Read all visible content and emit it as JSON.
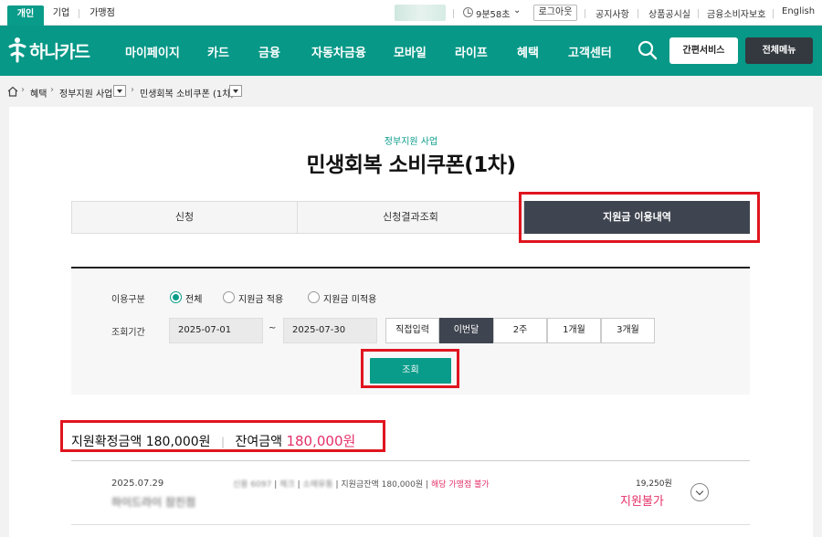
{
  "topbar": {
    "segments": [
      "개인",
      "기업",
      "가맹점"
    ],
    "timer": "9분58초",
    "logout": "로그아웃",
    "links": [
      "공지사항",
      "상품공시실",
      "금융소비자보호",
      "English"
    ]
  },
  "nav": {
    "logo": "하나카드",
    "items": [
      "마이페이지",
      "카드",
      "금융",
      "자동차금융",
      "모바일",
      "라이프",
      "혜택",
      "고객센터"
    ],
    "simple_service": "간편서비스",
    "all_menu": "전체메뉴"
  },
  "breadcrumb": {
    "items": [
      "혜택",
      "정부지원 사업",
      "민생회복 소비쿠폰 (1차)"
    ]
  },
  "page": {
    "subtitle": "정부지원 사업",
    "title": "민생회복 소비쿠폰(1차)"
  },
  "tabs": [
    "신청",
    "신청결과조회",
    "지원금 이용내역"
  ],
  "filter": {
    "usage_label": "이용구분",
    "radios": [
      "전체",
      "지원금 적용",
      "지원금 미적용"
    ],
    "period_label": "조회기간",
    "date_from": "2025-07-01",
    "tilde": "~",
    "date_to": "2025-07-30",
    "periods": [
      "직접입력",
      "이번달",
      "2주",
      "1개월",
      "3개월"
    ],
    "search_button": "조회"
  },
  "summary": {
    "confirmed_label": "지원확정금액",
    "confirmed_value": "180,000원",
    "remaining_label": "잔여금액",
    "remaining_value": "180,000원"
  },
  "transaction": {
    "date": "2025.07.29",
    "merchant": "하이드라이 잠진점",
    "meta_card": "신용 6097",
    "meta_sep1": "|",
    "meta_type": "체크",
    "meta_sep2": "|",
    "meta_cat": "소매유통",
    "meta_sep3": "|",
    "meta_balance": "지원금잔액 180,000원",
    "meta_sep4": "|",
    "meta_note": "해당 가맹점 불가",
    "amount": "19,250원",
    "status": "지원불가"
  },
  "colors": {
    "brand": "#079887",
    "accent_pink": "#e5306a",
    "dark_tab": "#3f4550",
    "highlight_red": "#e0151f"
  }
}
